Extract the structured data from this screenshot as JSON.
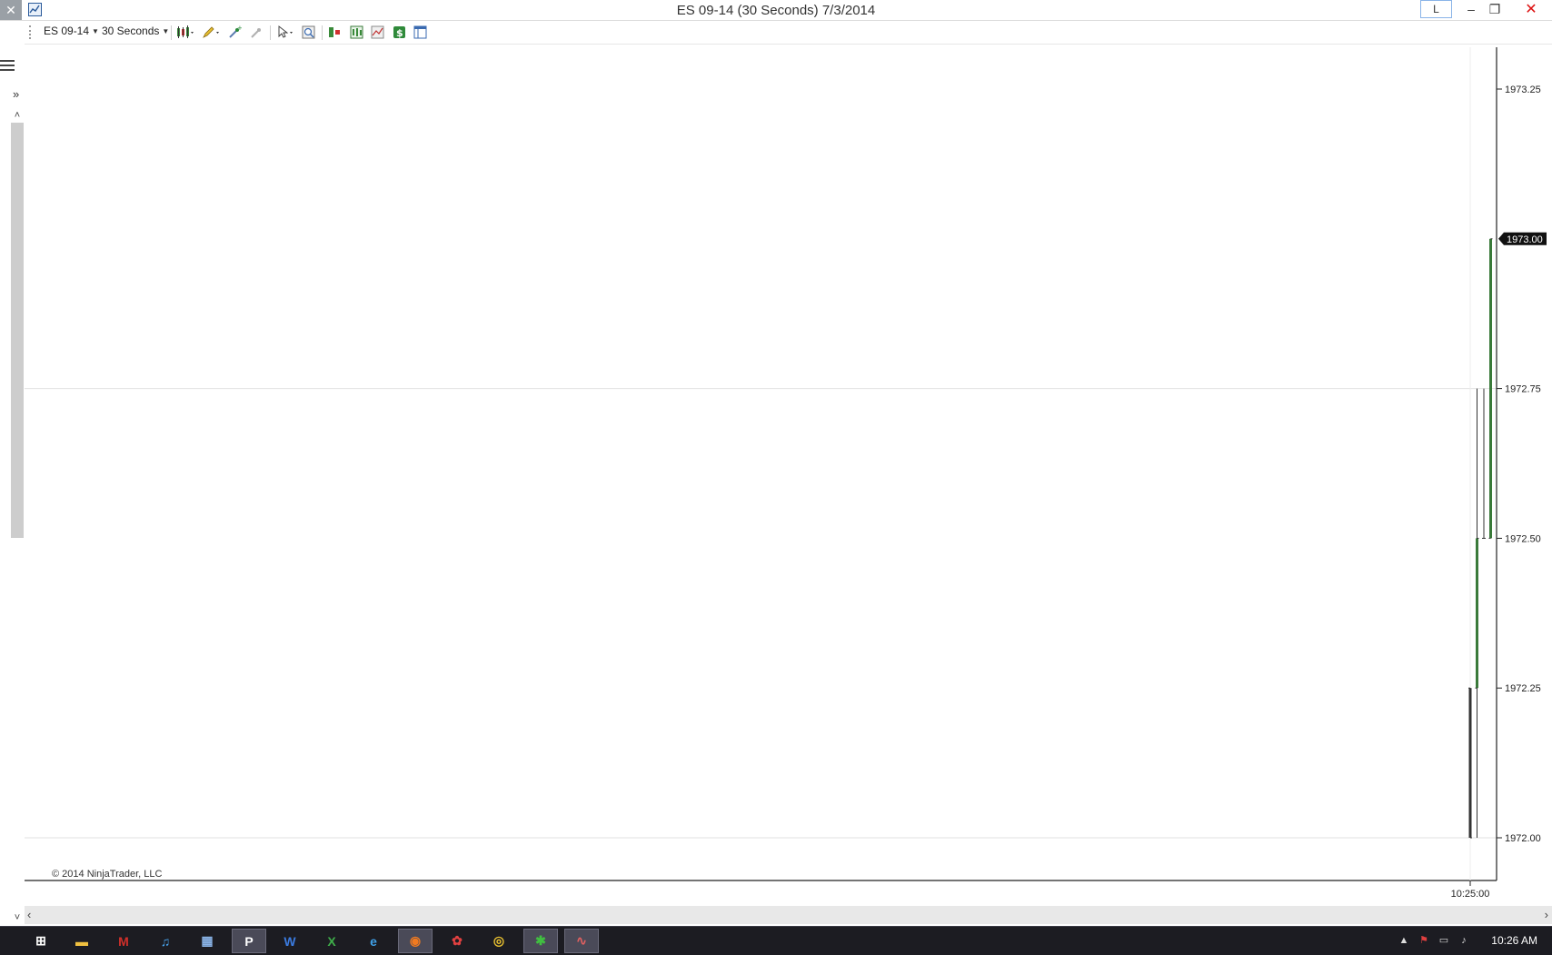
{
  "window": {
    "title": "ES 09-14 (30 Seconds)  7/3/2014",
    "l_button": "L",
    "close_left": "✕",
    "minimize": "–",
    "restore": "❐",
    "close": "✕"
  },
  "toolbar": {
    "instrument": "ES 09-14",
    "interval": "30 Seconds"
  },
  "left_panel": {
    "expand": "»"
  },
  "scrollbars": {
    "up": "˄",
    "down": "˅",
    "left": "‹",
    "right": "›"
  },
  "chart_data": {
    "type": "ohlc",
    "instrument": "ES 09-14",
    "interval": "30 Seconds",
    "y_ticks": [
      "1973.25",
      "1972.75",
      "1972.50",
      "1972.25",
      "1972.00"
    ],
    "y_range": [
      1971.95,
      1973.4
    ],
    "x_tick_labels": [
      "10:25:00"
    ],
    "bars": [
      {
        "open": 1972.25,
        "high": 1972.25,
        "low": 1972.0,
        "close": 1972.0,
        "color": "#333333"
      },
      {
        "open": 1972.25,
        "high": 1972.75,
        "low": 1972.0,
        "close": 1972.5,
        "color": "#3a7a3a"
      },
      {
        "open": 1972.5,
        "high": 1972.75,
        "low": 1972.5,
        "close": 1972.5,
        "color": "#333333"
      },
      {
        "open": 1972.5,
        "high": 1973.0,
        "low": 1972.5,
        "close": 1973.0,
        "color": "#3a7a3a"
      }
    ],
    "last_price": "1973.00",
    "grid": true,
    "copyright": "© 2014 NinjaTrader, LLC"
  },
  "taskbar": {
    "apps": [
      {
        "name": "start",
        "icon": "windows-icon",
        "color": "#ffffff",
        "label": "⊞"
      },
      {
        "name": "explorer",
        "icon": "folder-icon",
        "color": "#f0c040",
        "label": "▬"
      },
      {
        "name": "mcafee",
        "icon": "shield-icon",
        "color": "#d0302a",
        "label": "M"
      },
      {
        "name": "itunes",
        "icon": "music-icon",
        "color": "#49a5f0",
        "label": "♫"
      },
      {
        "name": "calculator",
        "icon": "calculator-icon",
        "color": "#8ab4e8",
        "label": "▦"
      },
      {
        "name": "publisher",
        "icon": "publisher-icon",
        "color": "#ffffff",
        "label": "P"
      },
      {
        "name": "word",
        "icon": "word-icon",
        "color": "#3b7be0",
        "label": "W"
      },
      {
        "name": "excel",
        "icon": "excel-icon",
        "color": "#3fae4a",
        "label": "X"
      },
      {
        "name": "internet-explorer",
        "icon": "ie-icon",
        "color": "#3fa0e8",
        "label": "e"
      },
      {
        "name": "firefox",
        "icon": "firefox-icon",
        "color": "#f07a20",
        "label": "◉"
      },
      {
        "name": "app-red",
        "icon": "red-app-icon",
        "color": "#e04040",
        "label": "✿"
      },
      {
        "name": "chrome",
        "icon": "chrome-icon",
        "color": "#e8c030",
        "label": "◎"
      },
      {
        "name": "ninjatrader",
        "icon": "ninjatrader-icon",
        "color": "#40c040",
        "label": "✱"
      },
      {
        "name": "app-swirl",
        "icon": "swirl-app-icon",
        "color": "#e06060",
        "label": "∿"
      }
    ],
    "tray": {
      "up_arrow": "▲",
      "flag": "⚑",
      "network": "▭",
      "volume": "♪",
      "clock": "10:26 AM"
    }
  }
}
